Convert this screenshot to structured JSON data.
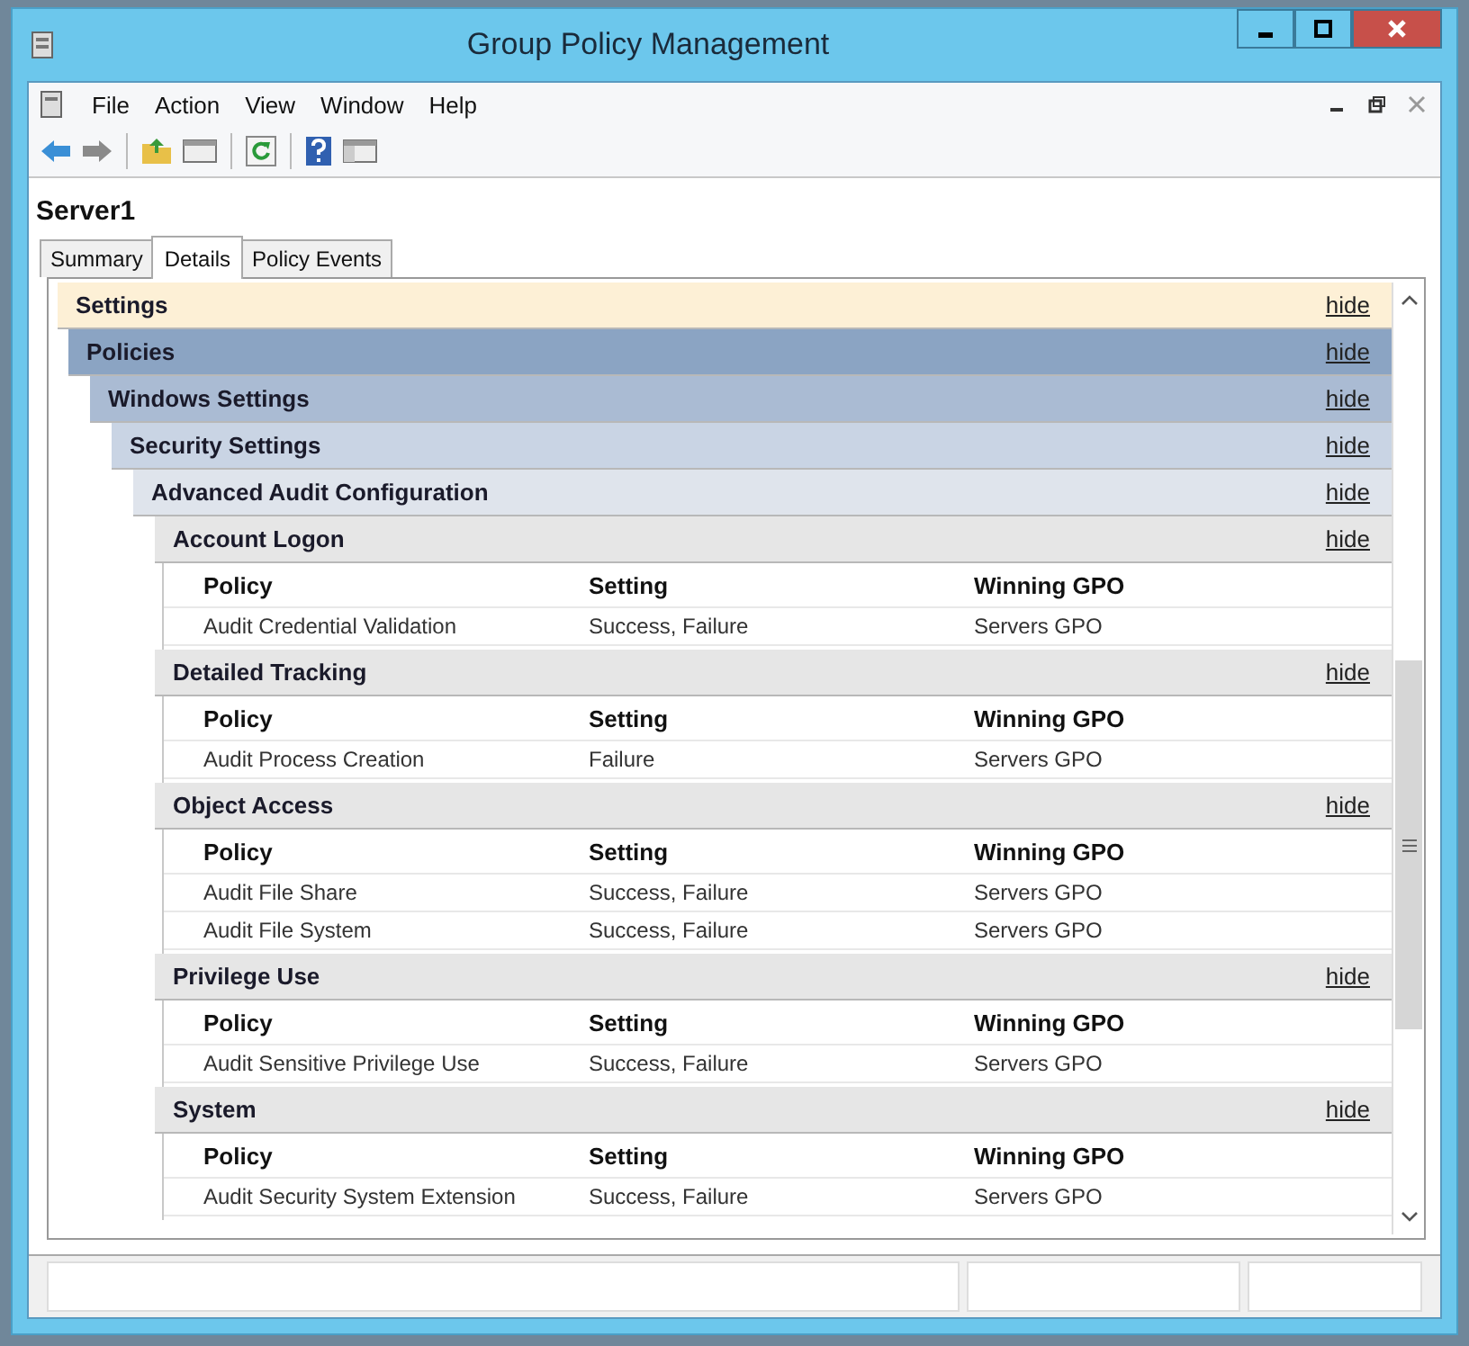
{
  "window": {
    "title": "Group Policy Management"
  },
  "menu": [
    "File",
    "Action",
    "View",
    "Window",
    "Help"
  ],
  "heading": "Server1",
  "tabs": [
    {
      "label": "Summary",
      "selected": false
    },
    {
      "label": "Details",
      "selected": true
    },
    {
      "label": "Policy Events",
      "selected": false
    }
  ],
  "report": {
    "title": "Settings",
    "link": "hide",
    "children": [
      {
        "title": "Policies",
        "link": "hide",
        "children": [
          {
            "title": "Windows Settings",
            "link": "hide",
            "children": [
              {
                "title": "Security Settings",
                "link": "hide",
                "children": [
                  {
                    "title": "Advanced Audit Configuration",
                    "link": "hide",
                    "children": [
                      {
                        "title": "Account Logon",
                        "link": "hide",
                        "columns": [
                          "Policy",
                          "Setting",
                          "Winning GPO"
                        ],
                        "rows": [
                          [
                            "Audit Credential Validation",
                            "Success, Failure",
                            "Servers GPO"
                          ]
                        ]
                      },
                      {
                        "title": "Detailed Tracking",
                        "link": "hide",
                        "columns": [
                          "Policy",
                          "Setting",
                          "Winning GPO"
                        ],
                        "rows": [
                          [
                            "Audit Process Creation",
                            "Failure",
                            "Servers GPO"
                          ]
                        ]
                      },
                      {
                        "title": "Object Access",
                        "link": "hide",
                        "columns": [
                          "Policy",
                          "Setting",
                          "Winning GPO"
                        ],
                        "rows": [
                          [
                            "Audit File Share",
                            "Success, Failure",
                            "Servers GPO"
                          ],
                          [
                            "Audit File System",
                            "Success, Failure",
                            "Servers GPO"
                          ]
                        ]
                      },
                      {
                        "title": "Privilege Use",
                        "link": "hide",
                        "columns": [
                          "Policy",
                          "Setting",
                          "Winning GPO"
                        ],
                        "rows": [
                          [
                            "Audit Sensitive Privilege Use",
                            "Success, Failure",
                            "Servers GPO"
                          ]
                        ]
                      },
                      {
                        "title": "System",
                        "link": "hide",
                        "columns": [
                          "Policy",
                          "Setting",
                          "Winning GPO"
                        ],
                        "rows": [
                          [
                            "Audit Security System Extension",
                            "Success, Failure",
                            "Servers GPO"
                          ]
                        ]
                      }
                    ]
                  }
                ]
              }
            ]
          }
        ]
      }
    ]
  }
}
